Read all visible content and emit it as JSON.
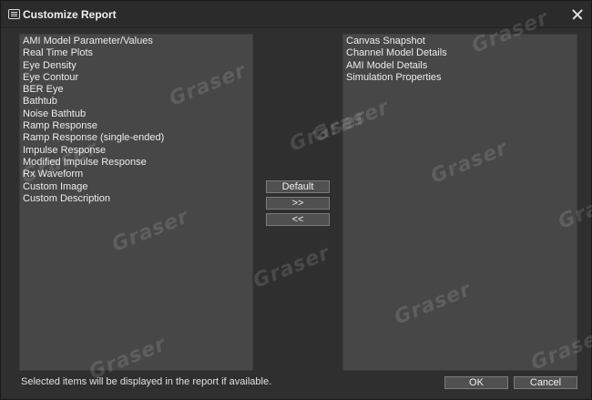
{
  "dialog": {
    "title": "Customize Report",
    "icon": "report-app-icon"
  },
  "available_items": [
    "AMI Model Parameter/Values",
    "Real Time Plots",
    "Eye Density",
    "Eye Contour",
    "BER Eye",
    "Bathtub",
    "Noise Bathtub",
    "Ramp Response",
    "Ramp Response (single-ended)",
    "Impulse Response",
    "Modified Impulse Response",
    "Rx Waveform",
    "Custom Image",
    "Custom Description"
  ],
  "selected_items": [
    "Canvas Snapshot",
    "Channel Model Details",
    "AMI Model Details",
    "Simulation Properties"
  ],
  "buttons": {
    "default": "Default",
    "add": ">>",
    "remove": "<<",
    "ok": "OK",
    "cancel": "Cancel"
  },
  "footer_note": "Selected items will be displayed in the report if available.",
  "watermark": "Graser"
}
